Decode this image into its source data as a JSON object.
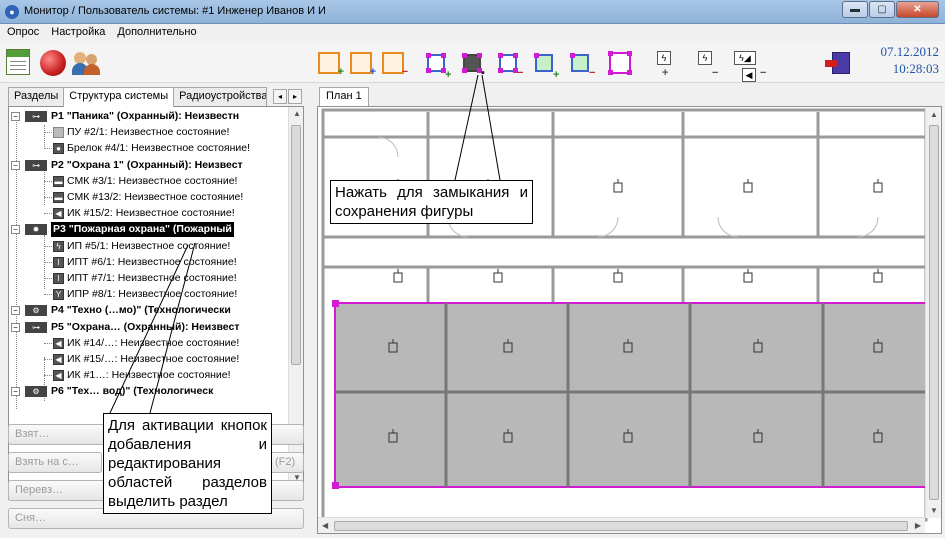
{
  "window": {
    "title": "Монитор / Пользователь системы: #1 Инженер Иванов И И",
    "app_icon": "app-monitor-icon",
    "controls": [
      "minimize",
      "maximize",
      "close"
    ]
  },
  "menu": [
    "Опрос",
    "Настройка",
    "Дополнительно"
  ],
  "toolbar": {
    "icons": [
      "report-icon",
      "globe-alarm-icon",
      "users-icon",
      "add-plan-icon",
      "add-plan-blue-icon",
      "remove-plan-icon",
      "add-area-icon",
      "close-save-figure-icon",
      "remove-area-icon",
      "add-point-icon",
      "remove-point-icon",
      "edit-areas-icon",
      "add-device-icon",
      "remove-device-icon",
      "move-device-icon",
      "exit-icon"
    ],
    "date": "07.12.2012",
    "time": "10:28:03",
    "colors": {
      "orange": "#e88a1e",
      "blue": "#3b63c9",
      "magenta": "#d21ad2"
    }
  },
  "left_tabs": [
    "Разделы",
    "Структура системы",
    "Радиоустройства"
  ],
  "tree": [
    {
      "label": "P1 \"Паника\" (Охранный): Неизвестн",
      "bold": true,
      "level": 0,
      "icon": "section-icon"
    },
    {
      "label": "ПУ #2/1: Неизвестное состояние!",
      "level": 1,
      "icon": "panel-icon"
    },
    {
      "label": "Брелок #4/1: Неизвестное состояние!",
      "level": 1,
      "icon": "keyfob-icon"
    },
    {
      "label": "P2 \"Охрана 1\" (Охранный): Неизвест",
      "bold": true,
      "level": 0,
      "icon": "section-icon"
    },
    {
      "label": "СМК #3/1: Неизвестное состояние!",
      "level": 1,
      "icon": "contact-icon"
    },
    {
      "label": "СМК #13/2: Неизвестное состояние!",
      "level": 1,
      "icon": "contact-icon"
    },
    {
      "label": "ИК #15/2: Неизвестное состояние!",
      "level": 1,
      "icon": "ir-icon"
    },
    {
      "label": "P3 \"Пожарная охрана\" (Пожарный",
      "bold": true,
      "selected": true,
      "level": 0,
      "icon": "fire-section-icon"
    },
    {
      "label": "ИП #5/1: Неизвестное состояние!",
      "level": 1,
      "icon": "smoke-icon"
    },
    {
      "label": "ИПТ #6/1: Неизвестное состояние!",
      "level": 1,
      "icon": "heat-icon"
    },
    {
      "label": "ИПТ #7/1: Неизвестное состояние!",
      "level": 1,
      "icon": "heat-icon"
    },
    {
      "label": "ИПР #8/1: Неизвестное состояние!",
      "level": 1,
      "icon": "manual-call-icon"
    },
    {
      "label": "P4 \"Техно (…мо)\" (Технологически",
      "bold": true,
      "level": 0,
      "icon": "tech-section-icon"
    },
    {
      "label": "P5 \"Охрана… (Охранный): Неизвест",
      "bold": true,
      "level": 0,
      "icon": "section-icon"
    },
    {
      "label": "ИК #14/…: Неизвестное состояние!",
      "level": 1,
      "icon": "ir-icon"
    },
    {
      "label": "ИК #15/…: Неизвестное состояние!",
      "level": 1,
      "icon": "ir-icon"
    },
    {
      "label": "ИК #1…: Неизвестное состояние!",
      "level": 1,
      "icon": "ir-icon"
    },
    {
      "label": "P6 \"Тех… вод)\" (Технологическ",
      "bold": true,
      "level": 0,
      "icon": "tech-section-icon"
    }
  ],
  "left_buttons": [
    "Взят…",
    "Взять на с…",
    "(F2)",
    "Перевз…",
    "Сня…"
  ],
  "plan": {
    "tab": "План 1",
    "highlight_color": "#d21ad2",
    "area_fill": "#b4b4b4"
  },
  "callouts": {
    "top": "Нажать для замыкания и сохранения фигуры",
    "bottom": "Для активации кнопок добавления и редактирования областей разделов выделить раздел"
  }
}
